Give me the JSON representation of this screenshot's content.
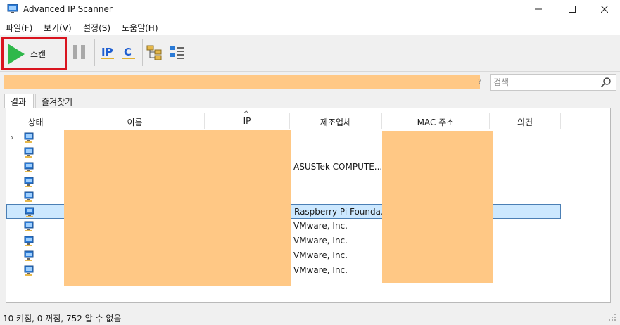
{
  "window": {
    "title": "Advanced IP Scanner"
  },
  "menu": [
    "파일(F)",
    "보기(V)",
    "설정(S)",
    "도움말(H)"
  ],
  "toolbar": {
    "scan_label": "스캔",
    "icons": [
      "play-icon",
      "pause-icon",
      "ip-icon",
      "c-subnet-icon",
      "network-tree-icon",
      "list-view-icon"
    ]
  },
  "search": {
    "placeholder": "검색"
  },
  "tabs": [
    "결과",
    "즐겨찾기"
  ],
  "columns": [
    "상태",
    "이름",
    "IP",
    "제조업체",
    "MAC 주소",
    "의견"
  ],
  "rows": [
    {
      "manufacturer": ""
    },
    {
      "manufacturer": ""
    },
    {
      "manufacturer": "ASUSTek COMPUTE..."
    },
    {
      "manufacturer": ""
    },
    {
      "manufacturer": ""
    },
    {
      "manufacturer": "Raspberry Pi Founda..."
    },
    {
      "manufacturer": "VMware, Inc."
    },
    {
      "manufacturer": "VMware, Inc."
    },
    {
      "manufacturer": "VMware, Inc."
    },
    {
      "manufacturer": "VMware, Inc."
    }
  ],
  "status": {
    "text": "10 켜짐, 0 꺼짐, 752 알 수 없음"
  },
  "colors": {
    "accent": "#2fb84a",
    "highlight": "#d9141f",
    "redaction": "#ffc885",
    "selection": "#cce8ff"
  }
}
